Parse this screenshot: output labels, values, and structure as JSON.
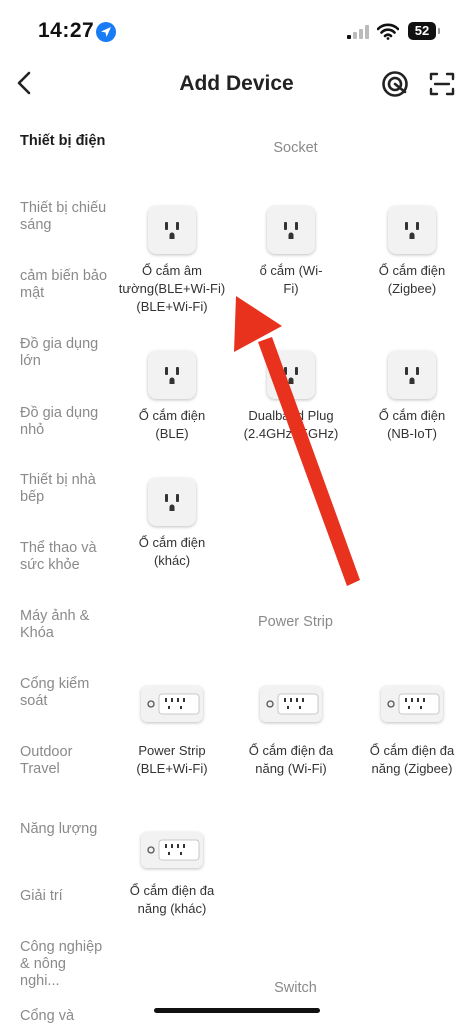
{
  "status": {
    "time": "14:27",
    "battery": "52"
  },
  "header": {
    "title": "Add Device"
  },
  "sidebar": {
    "items": [
      {
        "label": "Thiết bị điện"
      },
      {
        "label": "Thiết bị chiếu sáng"
      },
      {
        "label": "cảm biến bảo mật"
      },
      {
        "label": "Đồ gia dụng lớn"
      },
      {
        "label": "Đồ gia dụng nhỏ"
      },
      {
        "label": "Thiết bị nhà bếp"
      },
      {
        "label": "Thể thao và sức khỏe"
      },
      {
        "label": "Máy ảnh & Khóa"
      },
      {
        "label": "Cổng kiểm soát"
      },
      {
        "label": "Outdoor Travel"
      },
      {
        "label": "Năng lượng"
      },
      {
        "label": "Giải trí"
      },
      {
        "label": "Công nghiệp & nông nghi..."
      },
      {
        "label": "Cổng và"
      }
    ]
  },
  "sections": {
    "socket": {
      "title": "Socket",
      "devices": [
        {
          "label": "Ổ cắm âm tường(BLE+Wi-Fi) (BLE+Wi-Fi)"
        },
        {
          "label": "ổ cắm (Wi-Fi)"
        },
        {
          "label": "Ổ cắm điện (Zigbee)"
        },
        {
          "label": "Ổ cắm điện (BLE)"
        },
        {
          "label": "Dualband Plug (2.4GHz&5GHz)"
        },
        {
          "label": "Ổ cắm điện (NB-IoT)"
        },
        {
          "label": "Ổ cắm điện (khác)"
        }
      ]
    },
    "power_strip": {
      "title": "Power Strip",
      "devices": [
        {
          "label": "Power Strip (BLE+Wi-Fi)"
        },
        {
          "label": "Ổ cắm điện đa năng (Wi-Fi)"
        },
        {
          "label": "Ổ cắm điện đa năng (Zigbee)"
        },
        {
          "label": "Ổ cắm điện đa năng (khác)"
        }
      ]
    },
    "switch": {
      "title": "Switch"
    }
  },
  "colors": {
    "accent": "#1a7cf5",
    "arrow": "#e8321e",
    "active_text": "#1c1c1c",
    "muted_text": "#8a8a8a"
  }
}
